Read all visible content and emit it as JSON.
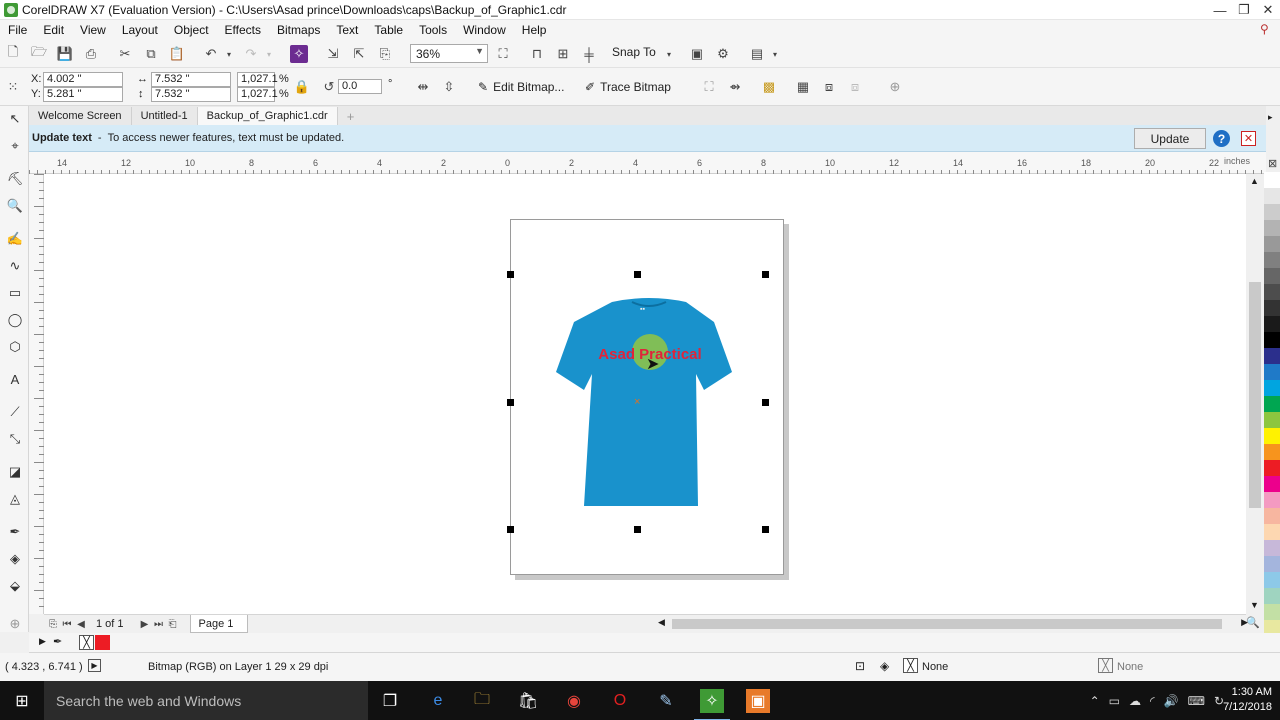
{
  "window": {
    "title": "CorelDRAW X7 (Evaluation Version) - C:\\Users\\Asad prince\\Downloads\\caps\\Backup_of_Graphic1.cdr",
    "minimize": "—",
    "restore": "❐",
    "close": "✕"
  },
  "menu": [
    "File",
    "Edit",
    "View",
    "Layout",
    "Object",
    "Effects",
    "Bitmaps",
    "Text",
    "Table",
    "Tools",
    "Window",
    "Help"
  ],
  "toolbar": {
    "zoom": "36%",
    "snap_to": "Snap To"
  },
  "properties": {
    "x": "4.002 \"",
    "y": "5.281 \"",
    "width": "7.532 \"",
    "height": "7.532 \"",
    "scale_w": "1,027.1",
    "scale_h": "1,027.1",
    "percent": "%",
    "rotation": "0.0",
    "degree": "°",
    "x_label": "X:",
    "y_label": "Y:",
    "edit_bitmap": "Edit Bitmap...",
    "trace_bitmap": "Trace Bitmap"
  },
  "tabs": [
    {
      "label": "Welcome Screen",
      "active": false
    },
    {
      "label": "Untitled-1",
      "active": false
    },
    {
      "label": "Backup_of_Graphic1.cdr",
      "active": true
    }
  ],
  "tab_add": "+",
  "infobar": {
    "title": "Update text",
    "separator": "-",
    "message": "To access newer features, text must be updated.",
    "button": "Update",
    "help": "?",
    "close": "✕"
  },
  "ruler": {
    "ticks": [
      "14",
      "12",
      "10",
      "8",
      "6",
      "4",
      "2",
      "0",
      "2",
      "4",
      "6",
      "8",
      "10",
      "12",
      "14",
      "16",
      "18",
      "20",
      "22"
    ],
    "unit": "inches"
  },
  "artwork": {
    "text": "Asad Practical",
    "shirt_color": "#1992cc",
    "text_color": "#e0243a",
    "circle_color": "#8cc34a"
  },
  "pagebar": {
    "count": "1 of 1",
    "page_tab": "Page 1"
  },
  "palette": [
    "#ffffff",
    "#e6e6e6",
    "#cccccc",
    "#b3b3b3",
    "#999999",
    "#808080",
    "#666666",
    "#4d4d4d",
    "#333333",
    "#1a1a1a",
    "#000000",
    "#2b2f8c",
    "#1f7ac8",
    "#00a5e0",
    "#00a651",
    "#8cc63f",
    "#fff200",
    "#f7941d",
    "#ed1c24",
    "#ec008c",
    "#f49ac1",
    "#f7b6a0",
    "#fdd7b1",
    "#c7b8d9",
    "#a4b5dd",
    "#8dc9e8",
    "#9fd4c0",
    "#c3e0a5",
    "#e8e8a0"
  ],
  "status": {
    "coords": "( 4.323 , 6.741 )",
    "object": "Bitmap (RGB) on Layer 1 29 x 29 dpi",
    "fill": "None",
    "outline": "None"
  },
  "taskbar": {
    "search": "Search the web and Windows",
    "time": "1:30 AM",
    "date": "7/12/2018"
  }
}
